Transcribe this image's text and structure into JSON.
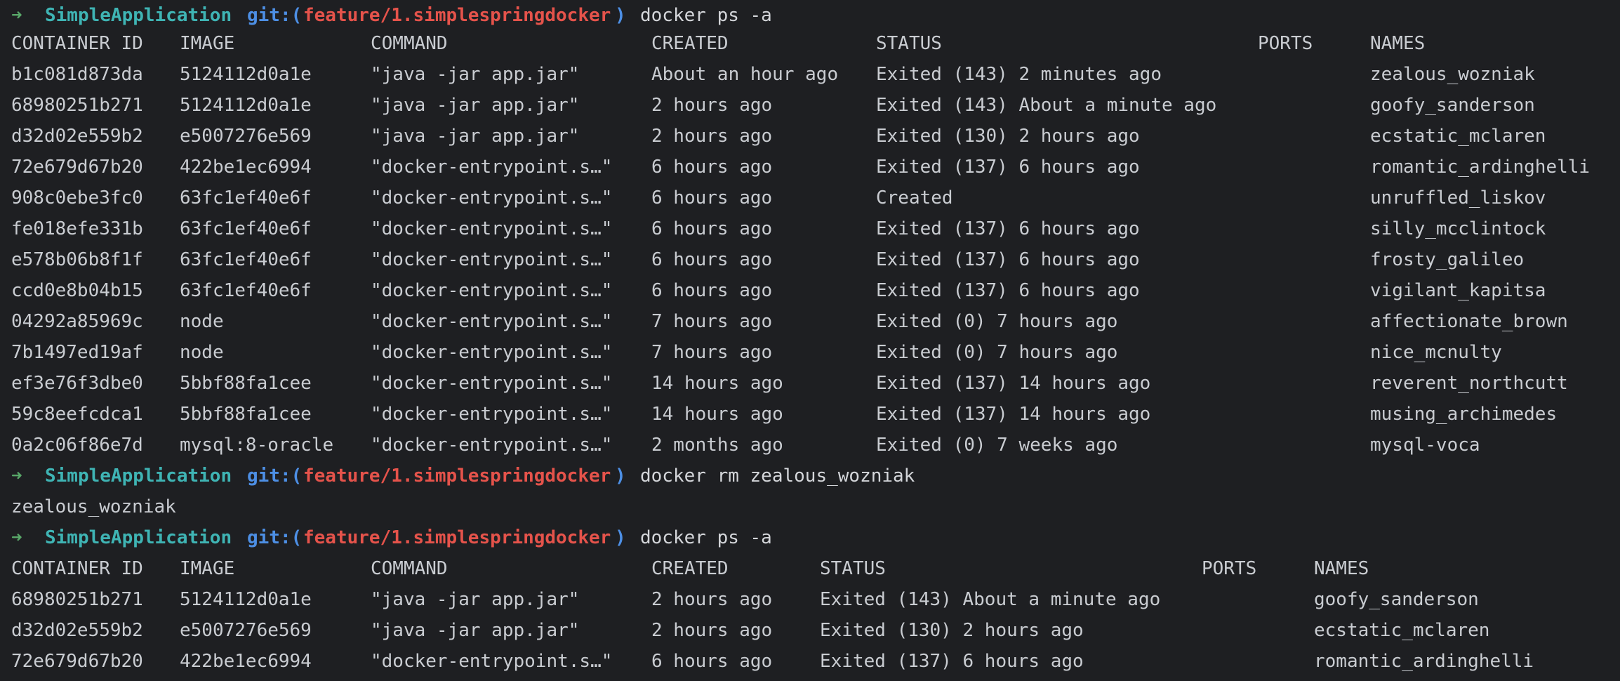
{
  "colors": {
    "background": "#1e1f22",
    "text": "#c9ccd1",
    "prompt_arrow": "#59a869",
    "prompt_dir": "#3fb4b4",
    "prompt_git": "#4d8fe5",
    "prompt_branch": "#e5534b"
  },
  "prompt": {
    "arrow": "➜",
    "dir": "SimpleApplication",
    "git_open": "git:(",
    "branch": "feature/1.simplespringdocker",
    "git_close": ")"
  },
  "commands": {
    "first": "docker ps -a",
    "second": "docker rm zealous_wozniak",
    "third": "docker ps -a"
  },
  "rm_output": "zealous_wozniak",
  "headers": {
    "container_id": "CONTAINER ID",
    "image": "IMAGE",
    "command": "COMMAND",
    "created": "CREATED",
    "status": "STATUS",
    "ports": "PORTS",
    "names": "NAMES"
  },
  "table1": [
    {
      "id": "b1c081d873da",
      "image": "5124112d0a1e",
      "command": "\"java -jar app.jar\"",
      "created": "About an hour ago",
      "status": "Exited (143) 2 minutes ago",
      "ports": "",
      "name": "zealous_wozniak"
    },
    {
      "id": "68980251b271",
      "image": "5124112d0a1e",
      "command": "\"java -jar app.jar\"",
      "created": "2 hours ago",
      "status": "Exited (143) About a minute ago",
      "ports": "",
      "name": "goofy_sanderson"
    },
    {
      "id": "d32d02e559b2",
      "image": "e5007276e569",
      "command": "\"java -jar app.jar\"",
      "created": "2 hours ago",
      "status": "Exited (130) 2 hours ago",
      "ports": "",
      "name": "ecstatic_mclaren"
    },
    {
      "id": "72e679d67b20",
      "image": "422be1ec6994",
      "command": "\"docker-entrypoint.s…\"",
      "created": "6 hours ago",
      "status": "Exited (137) 6 hours ago",
      "ports": "",
      "name": "romantic_ardinghelli"
    },
    {
      "id": "908c0ebe3fc0",
      "image": "63fc1ef40e6f",
      "command": "\"docker-entrypoint.s…\"",
      "created": "6 hours ago",
      "status": "Created",
      "ports": "",
      "name": "unruffled_liskov"
    },
    {
      "id": "fe018efe331b",
      "image": "63fc1ef40e6f",
      "command": "\"docker-entrypoint.s…\"",
      "created": "6 hours ago",
      "status": "Exited (137) 6 hours ago",
      "ports": "",
      "name": "silly_mcclintock"
    },
    {
      "id": "e578b06b8f1f",
      "image": "63fc1ef40e6f",
      "command": "\"docker-entrypoint.s…\"",
      "created": "6 hours ago",
      "status": "Exited (137) 6 hours ago",
      "ports": "",
      "name": "frosty_galileo"
    },
    {
      "id": "ccd0e8b04b15",
      "image": "63fc1ef40e6f",
      "command": "\"docker-entrypoint.s…\"",
      "created": "6 hours ago",
      "status": "Exited (137) 6 hours ago",
      "ports": "",
      "name": "vigilant_kapitsa"
    },
    {
      "id": "04292a85969c",
      "image": "node",
      "command": "\"docker-entrypoint.s…\"",
      "created": "7 hours ago",
      "status": "Exited (0) 7 hours ago",
      "ports": "",
      "name": "affectionate_brown"
    },
    {
      "id": "7b1497ed19af",
      "image": "node",
      "command": "\"docker-entrypoint.s…\"",
      "created": "7 hours ago",
      "status": "Exited (0) 7 hours ago",
      "ports": "",
      "name": "nice_mcnulty"
    },
    {
      "id": "ef3e76f3dbe0",
      "image": "5bbf88fa1cee",
      "command": "\"docker-entrypoint.s…\"",
      "created": "14 hours ago",
      "status": "Exited (137) 14 hours ago",
      "ports": "",
      "name": "reverent_northcutt"
    },
    {
      "id": "59c8eefcdca1",
      "image": "5bbf88fa1cee",
      "command": "\"docker-entrypoint.s…\"",
      "created": "14 hours ago",
      "status": "Exited (137) 14 hours ago",
      "ports": "",
      "name": "musing_archimedes"
    },
    {
      "id": "0a2c06f86e7d",
      "image": "mysql:8-oracle",
      "command": "\"docker-entrypoint.s…\"",
      "created": "2 months ago",
      "status": "Exited (0) 7 weeks ago",
      "ports": "",
      "name": "mysql-voca"
    }
  ],
  "table2": [
    {
      "id": "68980251b271",
      "image": "5124112d0a1e",
      "command": "\"java -jar app.jar\"",
      "created": "2 hours ago",
      "status": "Exited (143) About a minute ago",
      "ports": "",
      "name": "goofy_sanderson"
    },
    {
      "id": "d32d02e559b2",
      "image": "e5007276e569",
      "command": "\"java -jar app.jar\"",
      "created": "2 hours ago",
      "status": "Exited (130) 2 hours ago",
      "ports": "",
      "name": "ecstatic_mclaren"
    },
    {
      "id": "72e679d67b20",
      "image": "422be1ec6994",
      "command": "\"docker-entrypoint.s…\"",
      "created": "6 hours ago",
      "status": "Exited (137) 6 hours ago",
      "ports": "",
      "name": "romantic_ardinghelli"
    }
  ]
}
